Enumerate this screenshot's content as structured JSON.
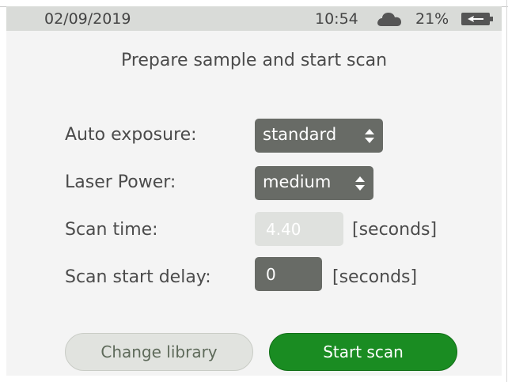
{
  "status_bar": {
    "date": "02/09/2019",
    "time": "10:54",
    "weather_icon": "cloud-icon",
    "battery_percent": "21%",
    "battery_icon": "battery-charging-icon"
  },
  "title": "Prepare sample and start scan",
  "settings": {
    "auto_exposure": {
      "label": "Auto exposure:",
      "value": "standard"
    },
    "laser_power": {
      "label": "Laser Power:",
      "value": "medium"
    },
    "scan_time": {
      "label": "Scan time:",
      "value": "4.40",
      "unit": "[seconds]"
    },
    "scan_start_delay": {
      "label": "Scan start delay:",
      "value": "0",
      "unit": "[seconds]"
    }
  },
  "buttons": {
    "change_library": "Change library",
    "start_scan": "Start scan"
  },
  "colors": {
    "status_bar_bg": "#d9dbd8",
    "control_dark": "#686b66",
    "control_disabled": "#dfe1de",
    "primary_green": "#1a8c22",
    "text": "#4b4b4b"
  }
}
